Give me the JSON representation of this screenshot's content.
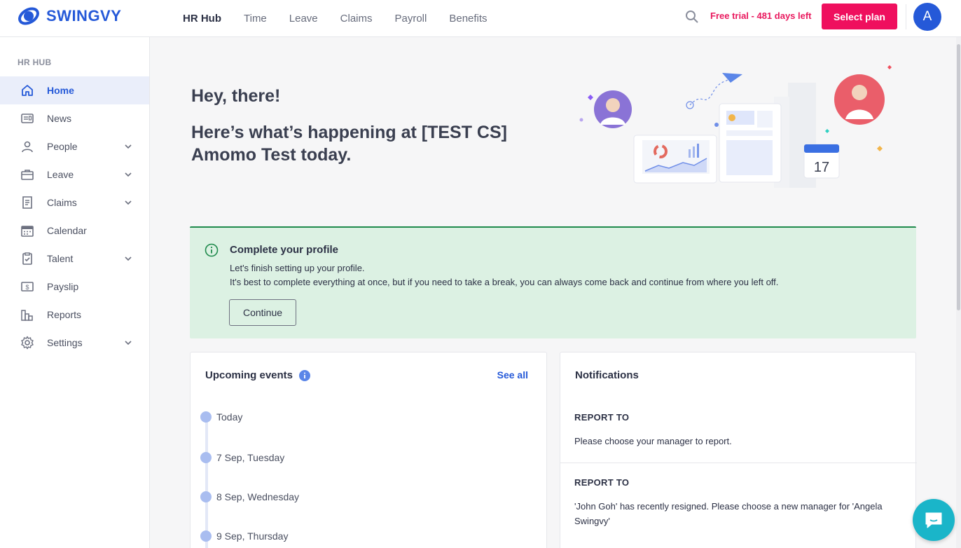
{
  "header": {
    "logo_text": "SWINGVY",
    "nav": [
      "HR Hub",
      "Time",
      "Leave",
      "Claims",
      "Payroll",
      "Benefits"
    ],
    "active_nav": "HR Hub",
    "trial_text": "Free trial - 481 days left",
    "select_plan_label": "Select plan",
    "avatar_initial": "A"
  },
  "sidebar": {
    "heading": "HR HUB",
    "items": [
      {
        "label": "Home",
        "icon": "home-icon",
        "active": true,
        "expandable": false
      },
      {
        "label": "News",
        "icon": "news-icon",
        "active": false,
        "expandable": false
      },
      {
        "label": "People",
        "icon": "person-icon",
        "active": false,
        "expandable": true
      },
      {
        "label": "Leave",
        "icon": "briefcase-icon",
        "active": false,
        "expandable": true
      },
      {
        "label": "Claims",
        "icon": "receipt-icon",
        "active": false,
        "expandable": true
      },
      {
        "label": "Calendar",
        "icon": "calendar-icon",
        "active": false,
        "expandable": false
      },
      {
        "label": "Talent",
        "icon": "clipboard-icon",
        "active": false,
        "expandable": true
      },
      {
        "label": "Payslip",
        "icon": "payslip-icon",
        "active": false,
        "expandable": false
      },
      {
        "label": "Reports",
        "icon": "bar-chart-icon",
        "active": false,
        "expandable": false
      },
      {
        "label": "Settings",
        "icon": "gear-icon",
        "active": false,
        "expandable": true
      }
    ]
  },
  "greeting": {
    "line1": "Hey, there!",
    "line2": "Here’s what’s happening at [TEST CS] Amomo Test today."
  },
  "hero": {
    "calendar_day": "17"
  },
  "profile_prompt": {
    "title": "Complete your profile",
    "line1": "Let's finish setting up your profile.",
    "line2": "It's best to complete everything at once, but if you need to take a break, you can always come back and continue from where you left off.",
    "button": "Continue"
  },
  "events": {
    "title": "Upcoming events",
    "see_all": "See all",
    "items": [
      "Today",
      "7 Sep, Tuesday",
      "8 Sep, Wednesday",
      "9 Sep, Thursday"
    ]
  },
  "notifications": {
    "title": "Notifications",
    "items": [
      {
        "heading": "REPORT TO",
        "text": "Please choose your manager to report."
      },
      {
        "heading": "REPORT TO",
        "text": "'John Goh' has recently resigned. Please choose a new manager for 'Angela Swingvy'"
      }
    ]
  },
  "colors": {
    "brand_blue": "#2559d8",
    "trial_pink": "#e9195e",
    "select_plan_bg": "#ef0f5e",
    "profile_box_bg": "#dcf1e3",
    "profile_box_border": "#1f8a4c",
    "chat_bubble": "#1ab5c9"
  }
}
